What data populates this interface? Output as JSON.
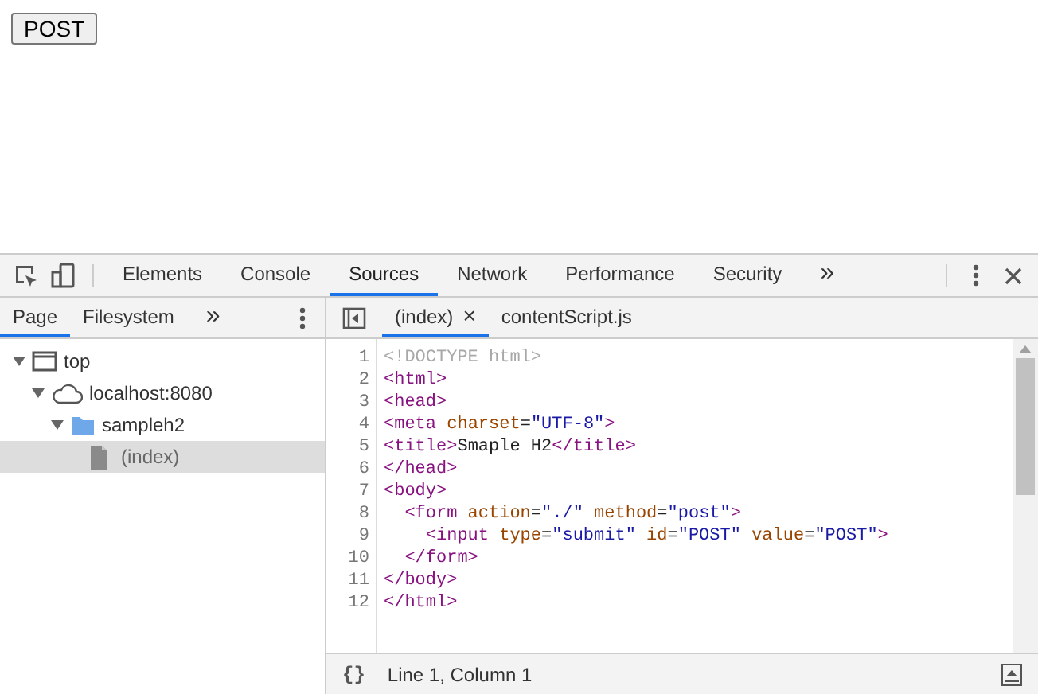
{
  "page": {
    "button": "POST"
  },
  "devtools": {
    "tabs": [
      {
        "label": "Elements",
        "selected": false
      },
      {
        "label": "Console",
        "selected": false
      },
      {
        "label": "Sources",
        "selected": true
      },
      {
        "label": "Network",
        "selected": false
      },
      {
        "label": "Performance",
        "selected": false
      },
      {
        "label": "Security",
        "selected": false
      }
    ],
    "more_tabs": "»",
    "navigator": {
      "tabs": [
        {
          "label": "Page",
          "selected": true
        },
        {
          "label": "Filesystem",
          "selected": false
        }
      ],
      "more_tabs": "»",
      "tree": [
        {
          "label": "top",
          "kind": "frame",
          "expanded": true,
          "selected": false,
          "children": [
            {
              "label": "localhost:8080",
              "kind": "cloud",
              "expanded": true,
              "selected": false,
              "children": [
                {
                  "label": "sampleh2",
                  "kind": "folder",
                  "expanded": true,
                  "selected": false,
                  "children": [
                    {
                      "label": "(index)",
                      "kind": "file",
                      "selected": true
                    }
                  ]
                }
              ]
            }
          ]
        }
      ]
    },
    "editor": {
      "tabs": [
        {
          "label": "(index)",
          "selected": true,
          "closable": true
        },
        {
          "label": "contentScript.js",
          "selected": false,
          "closable": false
        }
      ],
      "close_glyph": "×",
      "lines": [
        {
          "number": "1",
          "kind": "flush",
          "tokens": [
            {
              "kind": "doctype",
              "text": "<!DOCTYPE html>"
            }
          ]
        },
        {
          "number": "2",
          "kind": "flush",
          "tokens": [
            {
              "kind": "tag",
              "text": "<html>"
            }
          ]
        },
        {
          "number": "3",
          "kind": "flush",
          "tokens": [
            {
              "kind": "tag",
              "text": "<head>"
            }
          ]
        },
        {
          "number": "4",
          "kind": "flush",
          "tokens": [
            {
              "kind": "tag",
              "text": "<meta"
            },
            {
              "kind": "attr",
              "text": " charset"
            },
            {
              "kind": "plain",
              "text": "="
            },
            {
              "kind": "value",
              "text": "\"UTF-8\""
            },
            {
              "kind": "tag",
              "text": ">"
            }
          ]
        },
        {
          "number": "5",
          "kind": "flush",
          "tokens": [
            {
              "kind": "tag",
              "text": "<title>"
            },
            {
              "kind": "plain",
              "text": "Smaple H2"
            },
            {
              "kind": "tag",
              "text": "</title>"
            }
          ]
        },
        {
          "number": "6",
          "kind": "flush",
          "tokens": [
            {
              "kind": "tag",
              "text": "</head>"
            }
          ]
        },
        {
          "number": "7",
          "kind": "flush",
          "tokens": [
            {
              "kind": "tag",
              "text": "<body>"
            }
          ]
        },
        {
          "number": "8",
          "kind": "indented",
          "tokens": [
            {
              "kind": "tag",
              "text": "<form"
            },
            {
              "kind": "attr",
              "text": " action"
            },
            {
              "kind": "plain",
              "text": "="
            },
            {
              "kind": "value",
              "text": "\"./\""
            },
            {
              "kind": "attr",
              "text": " method"
            },
            {
              "kind": "plain",
              "text": "="
            },
            {
              "kind": "value",
              "text": "\"post\""
            },
            {
              "kind": "tag",
              "text": ">"
            }
          ]
        },
        {
          "number": "9",
          "kind": "deeper",
          "tokens": [
            {
              "kind": "tag",
              "text": "<input"
            },
            {
              "kind": "attr",
              "text": " type"
            },
            {
              "kind": "plain",
              "text": "="
            },
            {
              "kind": "value",
              "text": "\"submit\""
            },
            {
              "kind": "attr",
              "text": " id"
            },
            {
              "kind": "plain",
              "text": "="
            },
            {
              "kind": "value",
              "text": "\"POST\""
            },
            {
              "kind": "attr",
              "text": " value"
            },
            {
              "kind": "plain",
              "text": "="
            },
            {
              "kind": "value",
              "text": "\"POST\""
            },
            {
              "kind": "tag",
              "text": ">"
            }
          ]
        },
        {
          "number": "10",
          "kind": "indented",
          "tokens": [
            {
              "kind": "tag",
              "text": "</form>"
            }
          ]
        },
        {
          "number": "11",
          "kind": "flush",
          "tokens": [
            {
              "kind": "tag",
              "text": "</body>"
            }
          ]
        },
        {
          "number": "12",
          "kind": "flush",
          "tokens": [
            {
              "kind": "tag",
              "text": "</html>"
            }
          ]
        }
      ]
    },
    "status_bar": {
      "format_glyph": "{}",
      "position": "Line 1, Column 1"
    }
  }
}
